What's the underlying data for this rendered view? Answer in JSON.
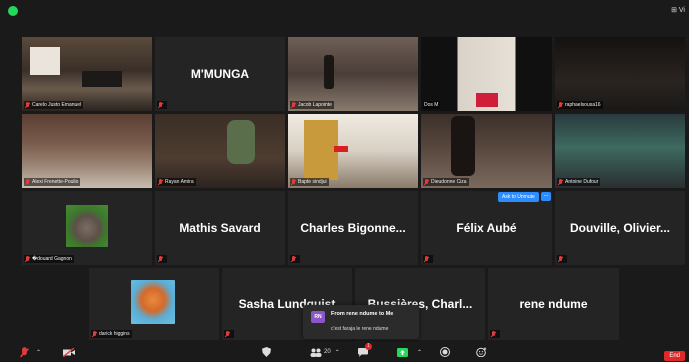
{
  "top": {
    "view_label": "⊞ Vi"
  },
  "tiles": [
    {
      "label": "Carelo Justo Emanuel",
      "big": ""
    },
    {
      "label": "",
      "big": "M'MUNGA"
    },
    {
      "label": "Jacob Lapointe",
      "big": ""
    },
    {
      "label": "Dos M",
      "big": ""
    },
    {
      "label": "raphaelsousa16",
      "big": ""
    },
    {
      "label": "Alexi Frenette-Poulio",
      "big": ""
    },
    {
      "label": "Rayan Amira",
      "big": ""
    },
    {
      "label": "Bapte sindjui",
      "big": ""
    },
    {
      "label": "Dieudonne Ciza",
      "big": ""
    },
    {
      "label": "Antoine Dufour",
      "big": ""
    },
    {
      "label": "�douard Gagnon",
      "big": ""
    },
    {
      "label": "",
      "big": "Mathis Savard"
    },
    {
      "label": "",
      "big": "Charles  Bigonne..."
    },
    {
      "label": "",
      "big": "Félix Aubé"
    },
    {
      "label": "",
      "big": "Douville,  Olivier..."
    },
    {
      "label": "darick higgins",
      "big": ""
    },
    {
      "label": "",
      "big": "Sasha Lundquist"
    },
    {
      "label": "",
      "big": "Bussières,  Charl..."
    },
    {
      "label": "",
      "big": "rene ndume"
    }
  ],
  "unmute": {
    "ask": "Ask to Unmute",
    "more": "..."
  },
  "chat": {
    "initials": "RN",
    "from": "From rene ndume to Me",
    "message": "c'est faraja le rene ndume"
  },
  "toolbar": {
    "participants_count": "20",
    "chat_badge": "1",
    "end": "End"
  },
  "colors": {
    "accent": "#2d8cff",
    "active_border": "#c8dc4b",
    "muted": "#e23b3b",
    "end": "#e02828"
  }
}
